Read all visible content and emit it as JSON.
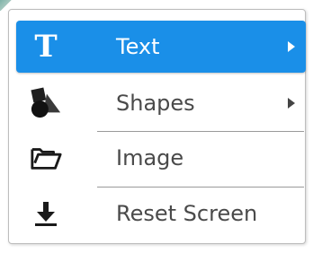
{
  "menu": {
    "items": [
      {
        "label": "Text",
        "icon": "text-icon",
        "has_submenu": true,
        "active": true
      },
      {
        "label": "Shapes",
        "icon": "shapes-icon",
        "has_submenu": true,
        "active": false
      },
      {
        "label": "Image",
        "icon": "folder-icon",
        "has_submenu": false,
        "active": false
      },
      {
        "label": "Reset Screen",
        "icon": "download-icon",
        "has_submenu": false,
        "active": false
      }
    ],
    "text_icon_glyph": "T"
  },
  "colors": {
    "active_background": "#1a8fe8",
    "active_text": "#ffffff",
    "text": "#4a4a4a",
    "icon": "#222222",
    "divider": "#9a9a9a"
  }
}
